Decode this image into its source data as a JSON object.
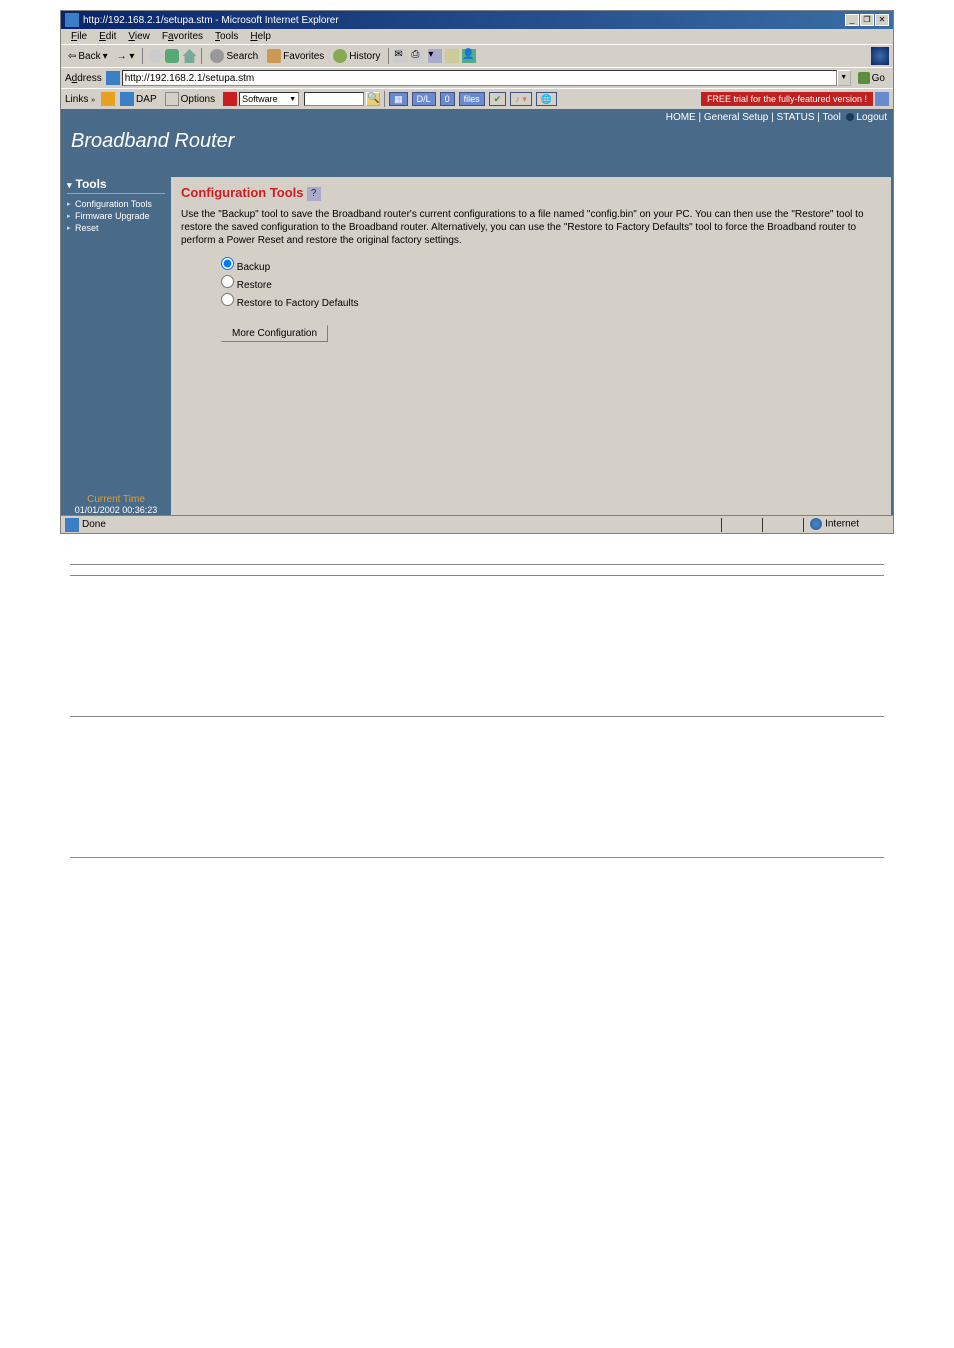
{
  "titlebar": {
    "text": "http://192.168.2.1/setupa.stm - Microsoft Internet Explorer"
  },
  "menubar": {
    "items": [
      "File",
      "Edit",
      "View",
      "Favorites",
      "Tools",
      "Help"
    ]
  },
  "toolbar": {
    "back": "Back",
    "search": "Search",
    "favorites": "Favorites",
    "history": "History"
  },
  "addressbar": {
    "label": "Address",
    "value": "http://192.168.2.1/setupa.stm",
    "go": "Go"
  },
  "linksbar": {
    "label": "Links",
    "dap": "DAP",
    "options": "Options",
    "software": "Software",
    "dl": "D/L",
    "zero": "0",
    "files": "files",
    "trial": "FREE trial for the fully-featured version !"
  },
  "topnav": {
    "home": "HOME",
    "general": "General Setup",
    "status": "STATUS",
    "tool": "Tool",
    "logout": "Logout"
  },
  "brand": "Broadband Router",
  "sidebar": {
    "title": "Tools",
    "items": [
      "Configuration Tools",
      "Firmware Upgrade",
      "Reset"
    ]
  },
  "currenttime": {
    "label": "Current Time",
    "value": "01/01/2002 00:36:23"
  },
  "content": {
    "title": "Configuration Tools",
    "help": "?",
    "desc": "Use the \"Backup\" tool to save the Broadband router's current configurations to a file named \"config.bin\" on your PC. You can then use the \"Restore\" tool to restore the saved configuration to the Broadband router. Alternatively, you can use the \"Restore to Factory Defaults\" tool to force the Broadband router to perform a Power Reset and restore the original factory settings.",
    "radios": {
      "backup": "Backup",
      "restore": "Restore",
      "factory": "Restore to Factory Defaults"
    },
    "more_btn": "More Configuration"
  },
  "statusbar": {
    "done": "Done",
    "zone": "Internet"
  }
}
